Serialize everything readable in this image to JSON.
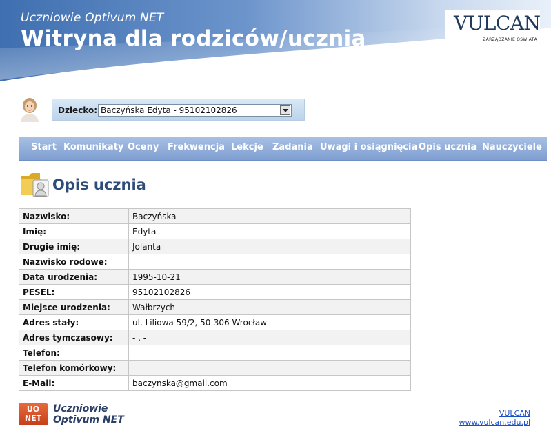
{
  "header": {
    "subtitle": "Uczniowie Optivum NET",
    "title": "Witryna dla rodziców/ucznia",
    "logo": {
      "name": "VULCAN",
      "tagline": "ZARZĄDZANIE OŚWIATĄ"
    }
  },
  "child_selector": {
    "label": "Dziecko:",
    "selected": "Baczyńska Edyta - 95102102826"
  },
  "nav": {
    "items": [
      "Start",
      "Komunikaty",
      "Oceny",
      "Frekwencja",
      "Lekcje",
      "Zadania",
      "Uwagi i osiągnięcia",
      "Opis ucznia",
      "Nauczyciele"
    ]
  },
  "page": {
    "title": "Opis ucznia"
  },
  "student": {
    "rows": [
      {
        "label": "Nazwisko:",
        "value": "Baczyńska"
      },
      {
        "label": "Imię:",
        "value": "Edyta"
      },
      {
        "label": "Drugie imię:",
        "value": "Jolanta"
      },
      {
        "label": "Nazwisko rodowe:",
        "value": ""
      },
      {
        "label": "Data urodzenia:",
        "value": "1995-10-21"
      },
      {
        "label": "PESEL:",
        "value": "95102102826"
      },
      {
        "label": "Miejsce urodzenia:",
        "value": "Wałbrzych"
      },
      {
        "label": "Adres stały:",
        "value": "ul. Liliowa 59/2, 50-306 Wrocław"
      },
      {
        "label": "Adres tymczasowy:",
        "value": "- , -"
      },
      {
        "label": "Telefon:",
        "value": ""
      },
      {
        "label": "Telefon komórkowy:",
        "value": ""
      },
      {
        "label": "E-Mail:",
        "value": "baczynska@gmail.com"
      }
    ]
  },
  "footer": {
    "badge_line1": "UO",
    "badge_line2": "NET",
    "brand_line1": "Uczniowie",
    "brand_line2": "Optivum NET",
    "link1": "VULCAN",
    "link2": "www.vulcan.edu.pl"
  },
  "colors": {
    "header_blue": "#4a78b8",
    "nav_blue": "#8fadd9",
    "title_blue": "#2c4c79",
    "link_blue": "#1a4fc7",
    "badge_orange": "#d9532a"
  }
}
